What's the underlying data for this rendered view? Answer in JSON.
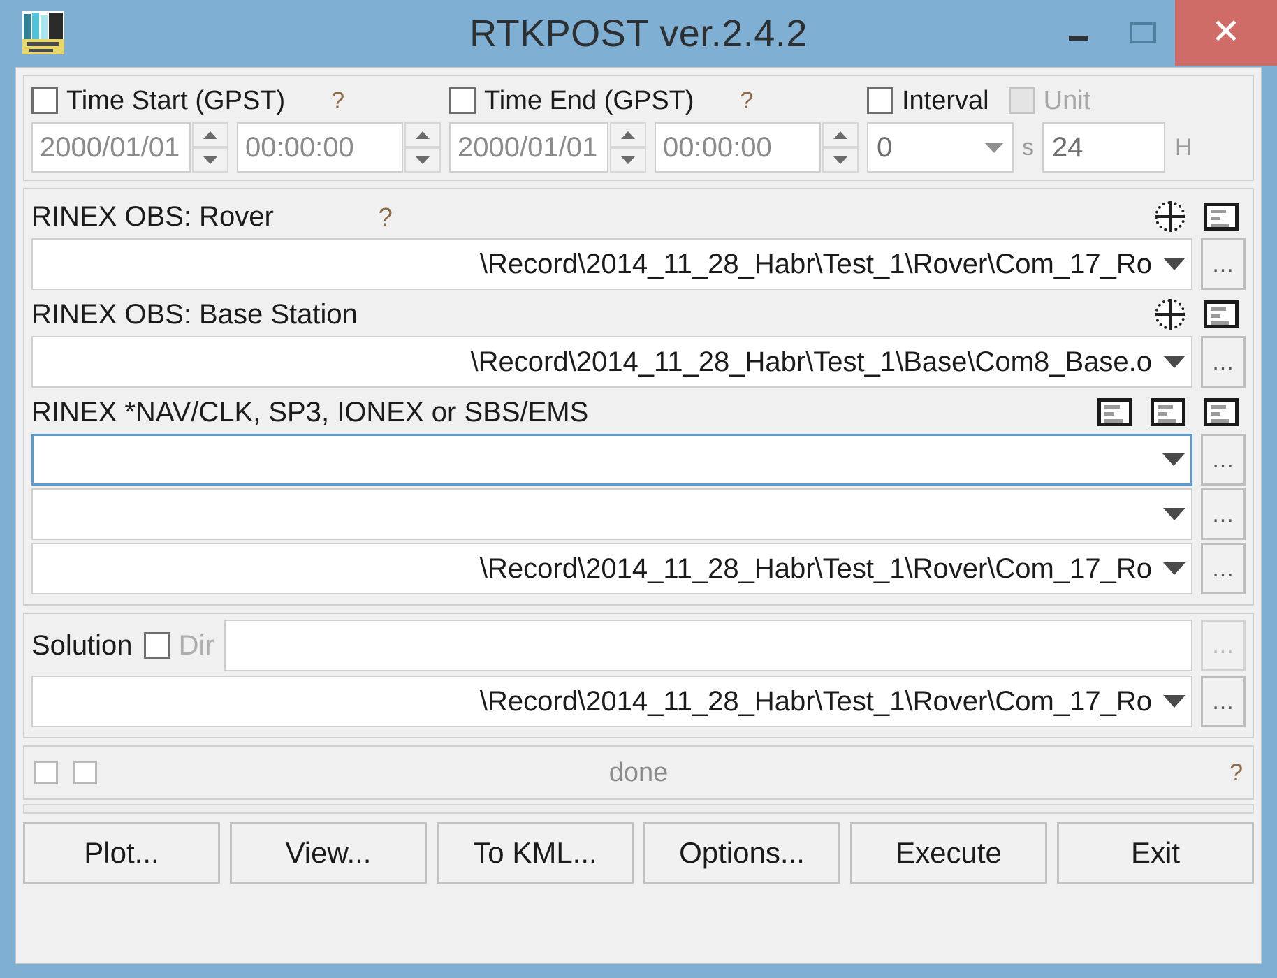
{
  "window": {
    "title": "RTKPOST ver.2.4.2",
    "icon": "rtkpost-app-icon",
    "minimize_label": "–",
    "maximize_label": "□",
    "close_label": "✕",
    "titlebar_color": "#7fb0d3",
    "close_color": "#d06c68",
    "focus_color": "#5b9bd5"
  },
  "time": {
    "start": {
      "checkbox_label": "Time Start (GPST)",
      "checked": false,
      "help": "?",
      "date": "2000/01/01",
      "time": "00:00:00"
    },
    "end": {
      "checkbox_label": "Time End (GPST)",
      "checked": false,
      "help": "?",
      "date": "2000/01/01",
      "time": "00:00:00"
    },
    "interval": {
      "checkbox_label": "Interval",
      "checked": false,
      "value": "0",
      "unit_suffix": "s"
    },
    "unit": {
      "checkbox_label": "Unit",
      "checked": false,
      "disabled": true,
      "value": "24",
      "unit_suffix": "H"
    }
  },
  "inputs": {
    "rover": {
      "label": "RINEX OBS: Rover",
      "help": "?",
      "path": "\\Record\\2014_11_28_Habr\\Test_1\\Rover\\Com_17_Ro",
      "browse_label": "..."
    },
    "base": {
      "label": "RINEX OBS: Base Station",
      "path": "\\Record\\2014_11_28_Habr\\Test_1\\Base\\Com8_Base.o",
      "browse_label": "..."
    },
    "nav": {
      "label": "RINEX *NAV/CLK, SP3, IONEX or SBS/EMS",
      "path1": "",
      "path2": "",
      "path3": "\\Record\\2014_11_28_Habr\\Test_1\\Rover\\Com_17_Ro",
      "browse_label": "..."
    }
  },
  "solution": {
    "label": "Solution",
    "dir_label": "Dir",
    "dir_checked": false,
    "dir_value": "",
    "dir_browse_label": "...",
    "path": "\\Record\\2014_11_28_Habr\\Test_1\\Rover\\Com_17_Ro",
    "browse_label": "..."
  },
  "status": {
    "message": "done",
    "help": "?"
  },
  "buttons": {
    "plot": "Plot...",
    "view": "View...",
    "to_kml": "To KML...",
    "options": "Options...",
    "execute": "Execute",
    "exit": "Exit"
  },
  "icons": {
    "globe": "globe-icon",
    "doc": "text-view-icon"
  }
}
